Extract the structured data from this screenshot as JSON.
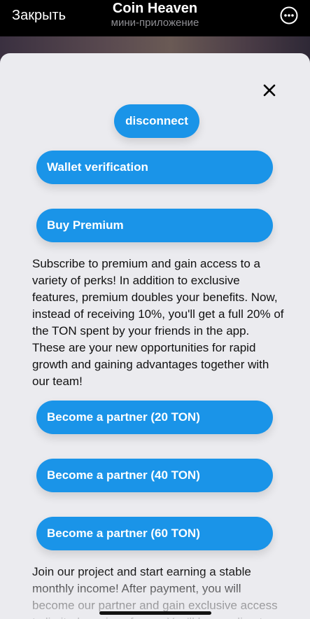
{
  "header": {
    "close_label": "Закрыть",
    "title": "Coin Heaven",
    "subtitle": "мини-приложение"
  },
  "sheet": {
    "disconnect_label": "disconnect",
    "wallet_verification_label": "Wallet verification",
    "buy_premium_label": "Buy Premium",
    "premium_description": "Subscribe to premium and gain access to a variety of perks! In addition to exclusive features, premium doubles your benefits. Now, instead of receiving 10%, you'll get a full 20% of the TON spent by your friends in the app. These are your new opportunities for rapid growth and gaining advantages together with our team!",
    "partner_20_label": "Become a partner (20 TON)",
    "partner_40_label": "Become a partner (40 TON)",
    "partner_60_label": "Become a partner (60 TON)",
    "partner_description": "Join our project and start earning a stable monthly income! After payment, you will become our partner and gain exclusive access to limited services for up. You'll be sending t"
  },
  "colors": {
    "accent": "#1a94e8",
    "sheet_background": "#ebebef",
    "header_background": "#000000"
  },
  "icons": {
    "more": "more-circle-icon",
    "close": "close-x-icon"
  }
}
